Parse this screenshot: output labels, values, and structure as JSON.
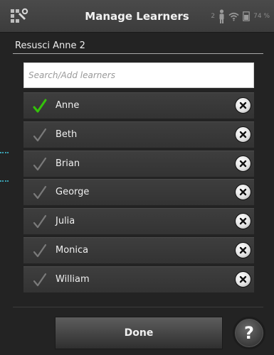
{
  "header": {
    "title": "Manage Learners",
    "app_icon": "wrench-grid-icon",
    "status": {
      "person_count": "2",
      "battery": "74 %"
    }
  },
  "device": {
    "name": "Resusci Anne 2"
  },
  "search": {
    "placeholder": "Search/Add learners"
  },
  "learners": [
    {
      "name": "Anne",
      "selected": true
    },
    {
      "name": "Beth",
      "selected": false
    },
    {
      "name": "Brian",
      "selected": false
    },
    {
      "name": "George",
      "selected": false
    },
    {
      "name": "Julia",
      "selected": false
    },
    {
      "name": "Monica",
      "selected": false
    },
    {
      "name": "William",
      "selected": false
    }
  ],
  "footer": {
    "done_label": "Done",
    "help_label": "?"
  },
  "colors": {
    "check_selected": "#34c20a",
    "check_unselected": "#7a7a7a",
    "accent_dots": "#3aa0b0"
  }
}
